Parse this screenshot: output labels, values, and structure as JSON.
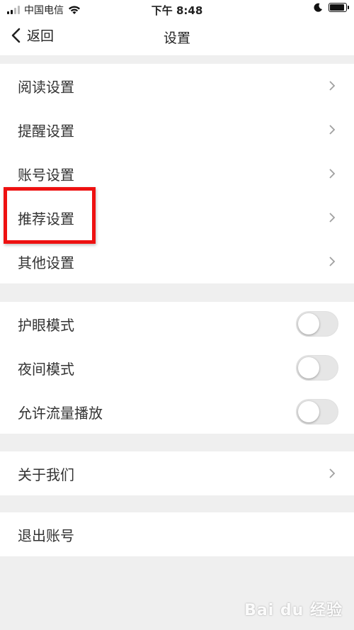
{
  "statusbar": {
    "carrier": "中国电信",
    "time": "下午 8:48",
    "battery_level": 0.9,
    "signal_bars": 2
  },
  "navbar": {
    "back_label": "返回",
    "title": "设置"
  },
  "group1": {
    "items": [
      {
        "label": "阅读设置"
      },
      {
        "label": "提醒设置"
      },
      {
        "label": "账号设置"
      },
      {
        "label": "推荐设置"
      },
      {
        "label": "其他设置"
      }
    ]
  },
  "group2": {
    "items": [
      {
        "label": "护眼模式",
        "on": false
      },
      {
        "label": "夜间模式",
        "on": false
      },
      {
        "label": "允许流量播放",
        "on": false
      }
    ]
  },
  "group3": {
    "items": [
      {
        "label": "关于我们"
      }
    ]
  },
  "group4": {
    "items": [
      {
        "label": "退出账号"
      }
    ]
  },
  "watermark": "Bai du 经验",
  "colors": {
    "highlight": "#ee1111",
    "background": "#efefef",
    "toggle_off": "#e6e6e6"
  }
}
